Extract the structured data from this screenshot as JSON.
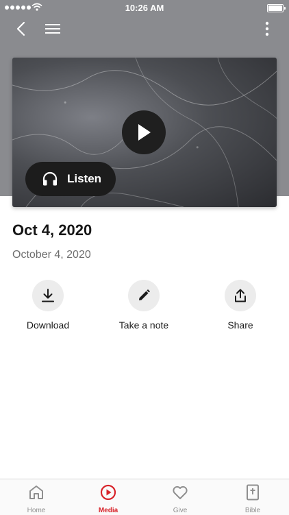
{
  "status_bar": {
    "time": "10:26 AM"
  },
  "header": {
    "icons": [
      "back-icon",
      "menu-icon",
      "more-options-icon"
    ]
  },
  "media": {
    "play_icon": "play-icon",
    "listen_label": "Listen",
    "listen_icon": "headphones-icon"
  },
  "content": {
    "title": "Oct 4, 2020",
    "subtitle": "October 4, 2020"
  },
  "actions": [
    {
      "label": "Download",
      "icon": "download-icon"
    },
    {
      "label": "Take a note",
      "icon": "pencil-icon"
    },
    {
      "label": "Share",
      "icon": "share-icon"
    }
  ],
  "tabbar": {
    "active": "Media",
    "accent_color": "#d8232a",
    "tabs": [
      {
        "label": "Home",
        "icon": "home-icon"
      },
      {
        "label": "Media",
        "icon": "media-play-icon"
      },
      {
        "label": "Give",
        "icon": "heart-icon"
      },
      {
        "label": "Bible",
        "icon": "bible-icon"
      }
    ]
  }
}
